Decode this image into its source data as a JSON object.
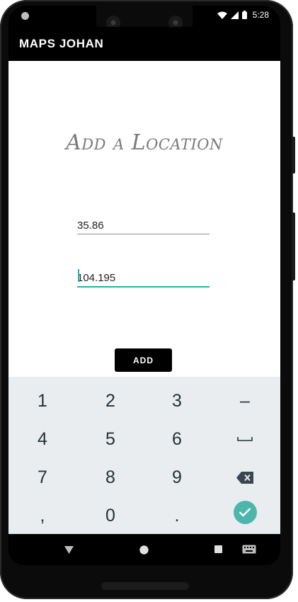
{
  "status_bar": {
    "time": "5:28",
    "icons": [
      "wifi-icon",
      "cell-signal-icon",
      "battery-icon"
    ]
  },
  "app_bar": {
    "title": "MAPS JOHAN"
  },
  "form": {
    "heading": "Add a Location",
    "latitude_value": "35.86",
    "longitude_value": "104.195",
    "add_label": "ADD"
  },
  "keyboard": {
    "keys": [
      {
        "name": "key-1",
        "label": "1"
      },
      {
        "name": "key-2",
        "label": "2"
      },
      {
        "name": "key-3",
        "label": "3"
      },
      {
        "name": "key-minus",
        "label": "–"
      },
      {
        "name": "key-4",
        "label": "4"
      },
      {
        "name": "key-5",
        "label": "5"
      },
      {
        "name": "key-6",
        "label": "6"
      },
      {
        "name": "key-space",
        "label": "␣"
      },
      {
        "name": "key-7",
        "label": "7"
      },
      {
        "name": "key-8",
        "label": "8"
      },
      {
        "name": "key-9",
        "label": "9"
      },
      {
        "name": "key-backspace",
        "label": ""
      },
      {
        "name": "key-comma",
        "label": ","
      },
      {
        "name": "key-0",
        "label": "0"
      },
      {
        "name": "key-period",
        "label": "."
      },
      {
        "name": "key-done",
        "label": ""
      }
    ]
  },
  "colors": {
    "accent": "#26b3a6",
    "done_button": "#4db6ac",
    "keyboard_bg": "#e9edf0",
    "heading": "#7a7a7a"
  },
  "nav_bar": {
    "icons": [
      "back-triangle-icon",
      "home-circle-icon",
      "recents-square-icon",
      "keyboard-switch-icon"
    ]
  }
}
